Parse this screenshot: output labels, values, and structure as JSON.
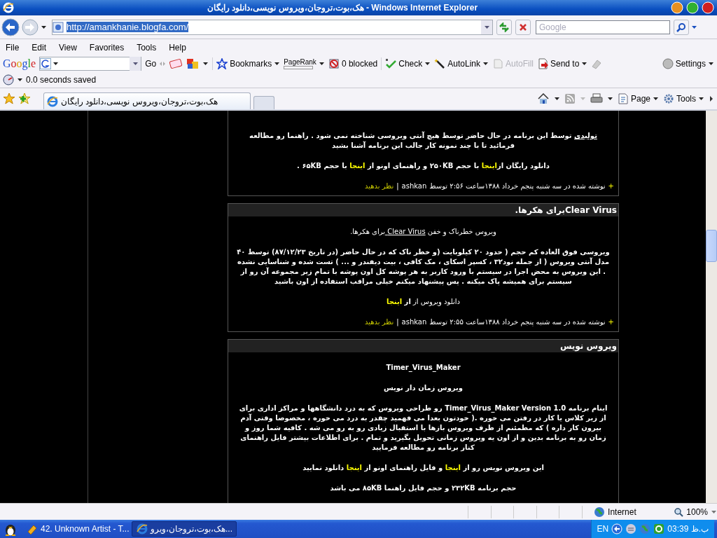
{
  "window": {
    "title": "هک،بوت،تروجان،ویروس نویسی،دانلود رایگان - Windows Internet Explorer"
  },
  "navigation": {
    "address": "http://amankhanie.blogfa.com/",
    "address_selected": true,
    "search_placeholder": "Google"
  },
  "menu": {
    "file": "File",
    "edit": "Edit",
    "view": "View",
    "favorites": "Favorites",
    "tools": "Tools",
    "help": "Help"
  },
  "google_toolbar": {
    "logo": "Google",
    "go": "Go",
    "items": {
      "bookmarks": {
        "label": "Bookmarks",
        "disabled": false,
        "dropdown": true
      },
      "pagerank": {
        "label": "PageRank",
        "disabled": false,
        "dropdown": true
      },
      "popup_blocker": {
        "label": "0 blocked",
        "disabled": false,
        "dropdown": false
      },
      "check": {
        "label": "Check",
        "disabled": false,
        "dropdown": true
      },
      "autolink": {
        "label": "AutoLink",
        "disabled": false,
        "dropdown": true
      },
      "autofill": {
        "label": "AutoFill",
        "disabled": true,
        "dropdown": false
      },
      "send_to": {
        "label": "Send to",
        "disabled": false,
        "dropdown": true
      }
    },
    "settings": "Settings"
  },
  "speed": "0.0 seconds saved",
  "tabs": [
    {
      "label": "هک،بوت،تروجان،ویروس نویسی،دانلود رایگان",
      "selected": true
    }
  ],
  "command_bar": {
    "page": {
      "label": "Page"
    },
    "tools": {
      "label": "Tools"
    }
  },
  "posts": [
    {
      "paragraphs": [
        {
          "bold": true,
          "segments": [
            {
              "kind": "underline",
              "text": "تولیدی"
            },
            {
              "kind": "text",
              "text": " توسط این برنامه در حال حاضر توسط هیچ آنتی ویروسی شناخته نمی شود . راهنما رو مطالعه فرمائید تا با چند نمونه کار جالب این برنامه آشنا بشید"
            }
          ]
        },
        {
          "bold": true,
          "segments": [
            {
              "kind": "text",
              "text": "دانلود رایگان از"
            },
            {
              "kind": "link",
              "text": "اینجا"
            },
            {
              "kind": "text",
              "text": " با حجم ۲۵۰KB  و راهنمای اونو از "
            },
            {
              "kind": "link",
              "text": "اینجا"
            },
            {
              "kind": "text",
              "text": " با حجم ۶۵KB ."
            }
          ]
        }
      ],
      "footer": {
        "plus": "+",
        "text": "نوشته شده در  سه شنبه پنجم خرداد ۱۳۸۸ساعت ۲:۵۶  توسط",
        "author": "ashkan",
        "separator": "|",
        "comment": "نظر بدهید"
      }
    },
    {
      "title": "Clear Virusبرای هکرها.",
      "paragraphs": [
        {
          "bold": false,
          "segments": [
            {
              "kind": "text",
              "text": "ویروس خطرناک و خفن "
            },
            {
              "kind": "underline",
              "text": "Clear Virus "
            },
            {
              "kind": "text",
              "text": "برای هکرها."
            }
          ]
        },
        {
          "bold": true,
          "segments": [
            {
              "kind": "text",
              "text": "ویروسی فوق العاده کم حجم ( حدود ۲۰ کیلوبایت (و خطر ناک که در حال حاضر (در تاریخ ۸۷/۱۲/۲۳) توسط ۴۰ مدل آنتی ویروس ( از جمله نود۳۲ ، کسپر اسکای ، مک کافی ، بیت دیفندر و ... ) تست شده و شناسایی نشده . این ویروس به محض اجرا در سیستم با ورود کاربر به هر پوشه کل اون پوشه با تمام زیر مجموعه آن رو از سیستم برای همیشه پاک میکنه . پس پیشنهاد میکنم خیلی مراقب استفاده از اون باشید"
            }
          ]
        },
        {
          "bold": false,
          "segments": [
            {
              "kind": "text",
              "text": "دانلود ویروس از "
            },
            {
              "kind": "bold",
              "text": "از "
            },
            {
              "kind": "link",
              "text": "اینجا"
            }
          ]
        }
      ],
      "footer": {
        "plus": "+",
        "text": "نوشته شده در  سه شنبه پنجم خرداد ۱۳۸۸ساعت ۲:۵۵  توسط",
        "author": "ashkan",
        "separator": "|",
        "comment": "نظر بدهید"
      }
    },
    {
      "title": "ویروس نویس",
      "paragraphs": [
        {
          "bold": true,
          "segments": [
            {
              "kind": "text",
              "text": "Timer_Virus_Maker"
            }
          ]
        },
        {
          "bold": true,
          "segments": [
            {
              "kind": "text",
              "text": "ویروس زمان دار نویس"
            }
          ]
        },
        {
          "bold": true,
          "segments": [
            {
              "kind": "text",
              "text": "اینام برنامه  Timer_Virus_Maker Version 1.0 رو طراحی ویروس که به درد دانشگاهها و مراکز اداری برای از زیر کلاس یا کار در رفتن می خوره .( خودتون بعدا می فهمید چقدر به درد می خوره ، مخصوصا وقتی آدم بیرون کار داره )  که مطمئنم از طرف ویروس بازها با استقبال زیادی رو به رو می شه . کافیه شما روز و زمان رو به برنامه بدین و از اون یه ویروس زمانی تحویل بگیرید و تمام . برای اطلاعات بیشتر فایل راهنمای کنار برنامه رو مطالعه فرمایید"
            }
          ]
        },
        {
          "bold": true,
          "segments": [
            {
              "kind": "text",
              "text": "این ویروس نویس رو از "
            },
            {
              "kind": "link",
              "text": "اینجا"
            },
            {
              "kind": "text",
              "text": " و فایل راهنمای اونو از "
            },
            {
              "kind": "link",
              "text": "اینجا"
            },
            {
              "kind": "text",
              "text": " دانلود نمایید"
            }
          ]
        },
        {
          "bold": true,
          "segments": [
            {
              "kind": "text",
              "text": "حجم برنامه ۲۳۲KB و حجم فایل راهنما ۸۵KB می باشد"
            }
          ]
        }
      ]
    }
  ],
  "status_bar": {
    "zone": "Internet",
    "zoom": "100%"
  },
  "taskbar": {
    "items": {
      "task_1": {
        "label": "42. Unknown Artist - T...",
        "selected": false
      },
      "task_2": {
        "label": "هک،بوت،تروجان،ویرو...",
        "selected": true
      }
    },
    "language": "EN",
    "clock": "03:39 ب.ظ"
  }
}
